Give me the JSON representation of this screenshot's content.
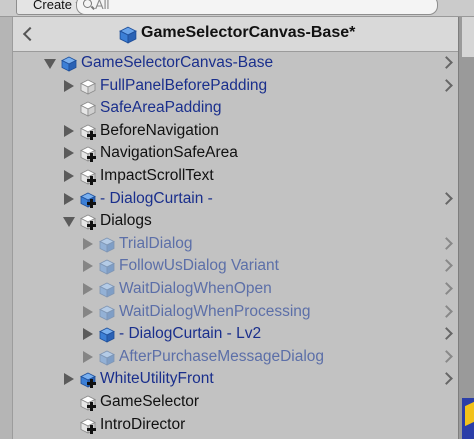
{
  "toolbar": {
    "create_label": "Create ▾",
    "search_placeholder": "All"
  },
  "header": {
    "title": "GameSelectorCanvas-Base*"
  },
  "tree": [
    {
      "label": "GameSelectorCanvas-Base",
      "indent": 0,
      "foldout": "open",
      "icon": "prefab-icon",
      "style": "blue",
      "chevron": true,
      "disabled": false
    },
    {
      "label": "FullPanelBeforePadding",
      "indent": 1,
      "foldout": "closed",
      "icon": "gameobject-icon",
      "style": "blue",
      "chevron": true,
      "disabled": false
    },
    {
      "label": "SafeAreaPadding",
      "indent": 1,
      "foldout": "none",
      "icon": "gameobject-icon",
      "style": "blue",
      "chevron": false,
      "disabled": false
    },
    {
      "label": "BeforeNavigation",
      "indent": 1,
      "foldout": "closed",
      "icon": "gameobject-added-icon",
      "style": "dark",
      "chevron": false,
      "disabled": false
    },
    {
      "label": "NavigationSafeArea",
      "indent": 1,
      "foldout": "closed",
      "icon": "gameobject-added-icon",
      "style": "dark",
      "chevron": false,
      "disabled": false
    },
    {
      "label": "ImpactScrollText",
      "indent": 1,
      "foldout": "closed",
      "icon": "gameobject-added-icon",
      "style": "dark",
      "chevron": false,
      "disabled": false
    },
    {
      "label": "- DialogCurtain -",
      "indent": 1,
      "foldout": "closed",
      "icon": "prefab-added-icon",
      "style": "blue",
      "chevron": true,
      "disabled": false
    },
    {
      "label": "Dialogs",
      "indent": 1,
      "foldout": "open",
      "icon": "gameobject-added-icon",
      "style": "dark",
      "chevron": false,
      "disabled": false
    },
    {
      "label": "TrialDialog",
      "indent": 2,
      "foldout": "closed",
      "icon": "prefab-faded-icon",
      "style": "blue-disabled",
      "chevron": true,
      "disabled": true
    },
    {
      "label": "FollowUsDialog Variant",
      "indent": 2,
      "foldout": "closed",
      "icon": "prefab-faded-icon",
      "style": "blue-disabled",
      "chevron": true,
      "disabled": true
    },
    {
      "label": "WaitDialogWhenOpen",
      "indent": 2,
      "foldout": "closed",
      "icon": "prefab-faded-icon",
      "style": "blue-disabled",
      "chevron": true,
      "disabled": true
    },
    {
      "label": "WaitDialogWhenProcessing",
      "indent": 2,
      "foldout": "closed",
      "icon": "prefab-faded-icon",
      "style": "blue-disabled",
      "chevron": true,
      "disabled": true
    },
    {
      "label": "- DialogCurtain - Lv2",
      "indent": 2,
      "foldout": "closed",
      "icon": "prefab-icon",
      "style": "blue",
      "chevron": true,
      "disabled": false
    },
    {
      "label": "AfterPurchaseMessageDialog",
      "indent": 2,
      "foldout": "closed",
      "icon": "prefab-faded-icon",
      "style": "blue-disabled",
      "chevron": true,
      "disabled": true
    },
    {
      "label": "WhiteUtilityFront",
      "indent": 1,
      "foldout": "closed",
      "icon": "prefab-added-icon",
      "style": "blue",
      "chevron": true,
      "disabled": false
    },
    {
      "label": "GameSelector",
      "indent": 1,
      "foldout": "none",
      "icon": "gameobject-added-icon",
      "style": "dark",
      "chevron": false,
      "disabled": false
    },
    {
      "label": "IntroDirector",
      "indent": 1,
      "foldout": "none",
      "icon": "gameobject-added-icon",
      "style": "dark",
      "chevron": false,
      "disabled": false
    }
  ],
  "colors": {
    "prefab_blue": "#3c7fd6",
    "prefab_faded": "#93b1d6",
    "gameobject_white": "#f2f2f2",
    "label_blue": "#1a2f8c",
    "label_dark": "#111111"
  }
}
